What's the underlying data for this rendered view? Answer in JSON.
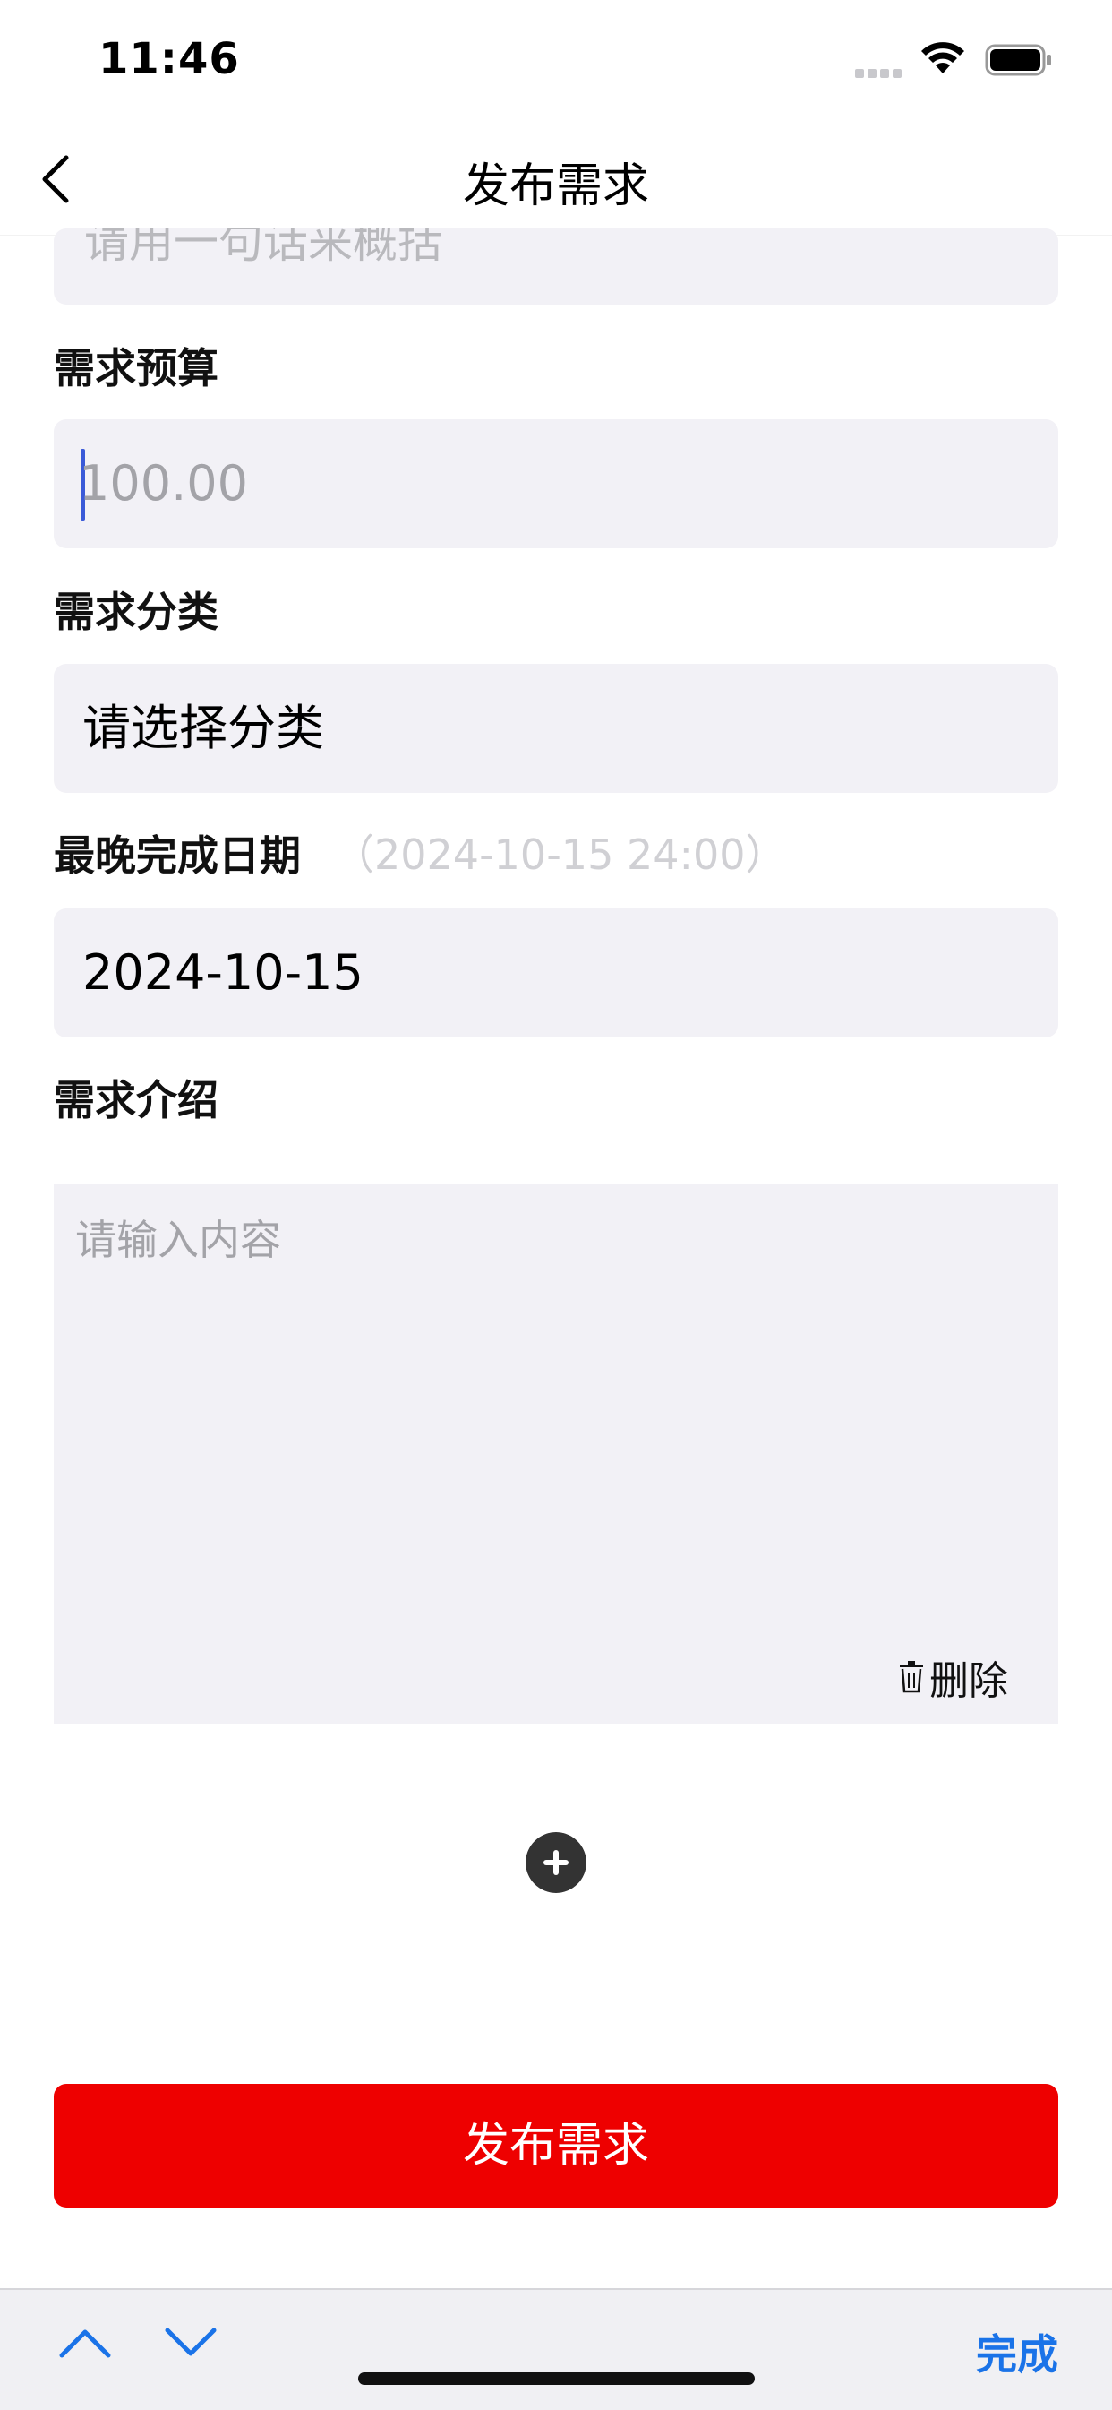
{
  "status_bar": {
    "time": "11:46"
  },
  "nav": {
    "title": "发布需求",
    "back_icon": "chevron-left-icon"
  },
  "form": {
    "title_placeholder": "请用一句话来概括",
    "budget": {
      "label": "需求预算",
      "placeholder": "100.00"
    },
    "category": {
      "label": "需求分类",
      "value": "请选择分类"
    },
    "deadline": {
      "label": "最晚完成日期",
      "hint": "（2024-10-15 24:00）",
      "value": "2024-10-15"
    },
    "intro": {
      "label": "需求介绍",
      "placeholder": "请输入内容",
      "delete_label": "删除",
      "delete_icon": "trash-icon"
    },
    "add_icon": "plus-circle-icon",
    "submit_label": "发布需求"
  },
  "keyboard_toolbar": {
    "up_icon": "chevron-up-icon",
    "down_icon": "chevron-down-icon",
    "done_label": "完成",
    "accent_color": "#1a73e8"
  },
  "colors": {
    "primary_button": "#ee0000",
    "field_background": "#f2f1f6",
    "caret": "#3a5ad8"
  }
}
